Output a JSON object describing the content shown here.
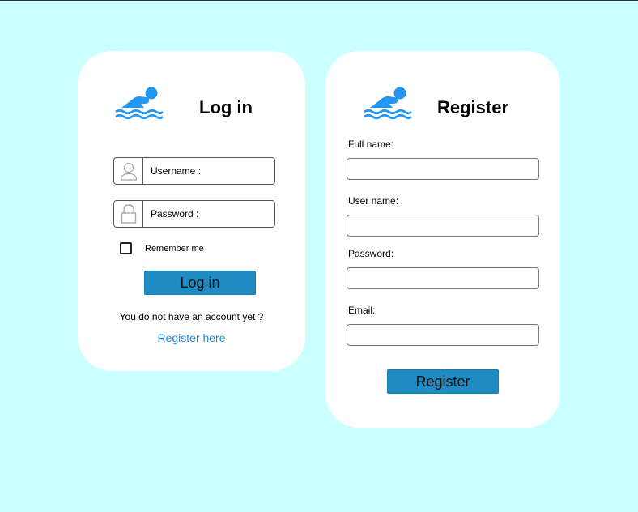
{
  "login": {
    "title": "Log in",
    "username_label": "Username :",
    "password_label": "Password :",
    "remember_label": "Remember me",
    "remember_checked": false,
    "login_button_label": "Log in",
    "no_account_text": "You do not have an account yet ?",
    "register_link_text": "Register here"
  },
  "register": {
    "title": "Register",
    "fullname_label": "Full name:",
    "fullname_value": "",
    "username_label": "User name:",
    "username_value": "",
    "password_label": "Password:",
    "password_value": "",
    "email_label": "Email:",
    "email_value": "",
    "register_button_label": "Register"
  },
  "icons": {
    "logo": "swimmer-icon",
    "username": "user-icon",
    "password": "lock-icon"
  },
  "colors": {
    "background": "#ccffff",
    "card": "#ffffff",
    "accent": "#1e8bc3",
    "logo": "#2196f3",
    "link": "#1e88d9"
  }
}
